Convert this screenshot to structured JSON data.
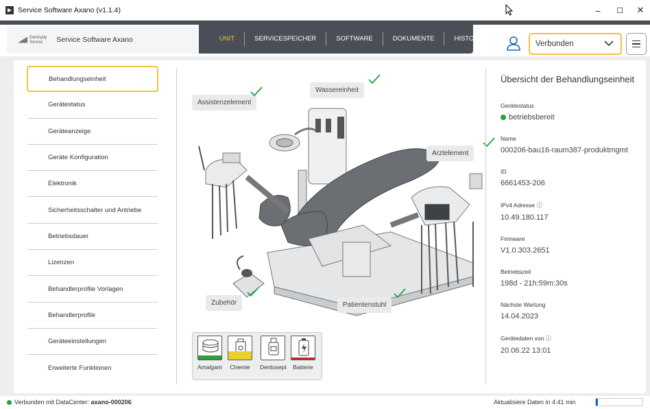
{
  "window": {
    "title": "Service Software Axano (v1.1.4)",
    "minimize": "–",
    "maximize": "☐",
    "close": "✕"
  },
  "brand": {
    "logo_line1": "Dentsply",
    "logo_line2": "Sirona",
    "name": "Service Software Axano"
  },
  "nav": {
    "tabs": [
      {
        "label": "UNIT",
        "active": true
      },
      {
        "label": "SERVICESPEICHER",
        "active": false
      },
      {
        "label": "SOFTWARE",
        "active": false
      },
      {
        "label": "DOKUMENTE",
        "active": false
      },
      {
        "label": "HISTORY",
        "active": false
      }
    ],
    "connection_value": "Verbunden"
  },
  "sidebar": {
    "items": [
      {
        "label": "Behandlungseinheit",
        "active": true
      },
      {
        "label": "Gerätestatus"
      },
      {
        "label": "Geräteanzeige"
      },
      {
        "label": "Geräte Konfiguration"
      },
      {
        "label": "Elektronik"
      },
      {
        "label": "Sicherheitsschalter und Antriebe"
      },
      {
        "label": "Betriebsdauer"
      },
      {
        "label": "Lizenzen"
      },
      {
        "label": "Behandlerprofile Vorlagen"
      },
      {
        "label": "Behandlerprofile"
      },
      {
        "label": "Geräteeinstellungen"
      },
      {
        "label": "Erweiterte Funktionen"
      }
    ]
  },
  "illustration": {
    "callouts": {
      "assistenzelement": "Assistenzelement",
      "wassereinheit": "Wassereinheit",
      "arztelement": "Arztelement",
      "zubehoer": "Zubehör",
      "patientenstuhl": "Patientenstuhl"
    },
    "supplies": [
      {
        "label": "Amalgam",
        "color": "#2e9d3e",
        "icon": "amalgam-icon"
      },
      {
        "label": "Chemie",
        "color": "#e8d12a",
        "icon": "chemie-icon"
      },
      {
        "label": "Dentosept",
        "color": "#ffffff",
        "icon": "dentosept-icon"
      },
      {
        "label": "Batterie",
        "color": "#c62828",
        "icon": "batterie-icon"
      }
    ]
  },
  "info": {
    "title": "Übersicht der Behandlungseinheit",
    "status_label": "Gerätestatus",
    "status_value": "betriebsbereit",
    "status_color": "#1fa53f",
    "name_label": "Name",
    "name_value": "000206-bau16-raum387-produktmgmt",
    "id_label": "ID",
    "id_value": "6661453-206",
    "ipv4_label": "IPv4 Adresse ⓘ",
    "ipv4_value": "10.49.180.117",
    "firmware_label": "Firmware",
    "firmware_value": "V1.0.303.2651",
    "uptime_label": "Betriebszeit",
    "uptime_value": "198d - 21h:59m:30s",
    "maintenance_label": "Nächste Wartung",
    "maintenance_value": "14.04.2023",
    "data_label": "Gerätedaten von ⓘ",
    "data_value": "20.06.22 13:01"
  },
  "statusbar": {
    "connected_prefix": "Verbunden mit DataCenter: ",
    "connected_name": "axano-000206",
    "refresh_text": "Aktualisiere Daten in 4:41 min",
    "refresh_progress": 0.05
  },
  "colors": {
    "accent": "#f0c040",
    "nav_dark": "#4a4f57",
    "ok_green": "#1fa53f",
    "user_blue": "#1565c0"
  }
}
